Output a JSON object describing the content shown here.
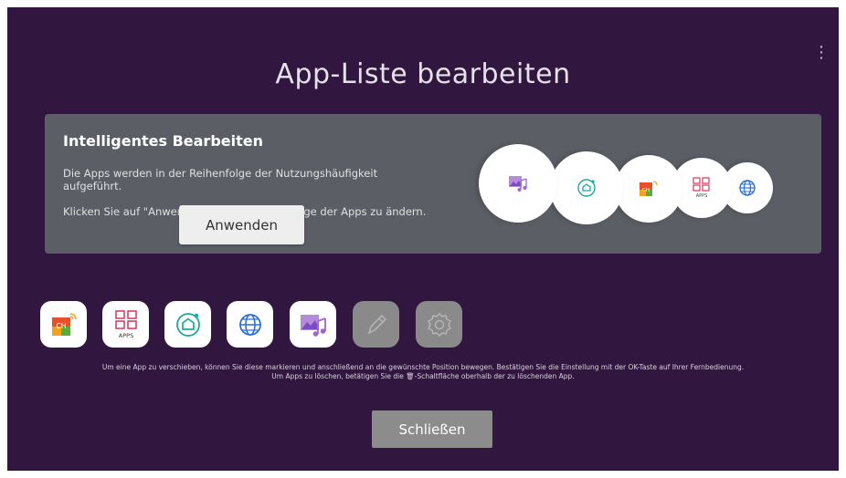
{
  "header": {
    "title": "App-Liste bearbeiten",
    "menu_icon": "more-vertical-icon"
  },
  "smart_edit": {
    "heading": "Intelligentes Bearbeiten",
    "description_line1": "Die Apps werden in der Reihenfolge der Nutzungshäufigkeit aufgeführt.",
    "description_line2": "Klicken Sie auf \"Anwenden\", um die Reihenfolge der Apps zu ändern.",
    "apply_label": "Anwenden",
    "preview_icons": [
      "photo-music-icon",
      "home-dashboard-icon",
      "live-tv-ch-icon",
      "apps-grid-icon",
      "web-browser-icon"
    ]
  },
  "apps": [
    {
      "name": "live-tv-ch-icon",
      "badge": "CH",
      "enabled": true
    },
    {
      "name": "apps-grid-icon",
      "badge": "APPS",
      "enabled": true
    },
    {
      "name": "home-dashboard-icon",
      "enabled": true
    },
    {
      "name": "web-browser-icon",
      "enabled": true
    },
    {
      "name": "photo-music-icon",
      "enabled": true
    },
    {
      "name": "edit-pencil-icon",
      "enabled": false
    },
    {
      "name": "settings-gear-icon",
      "enabled": false
    }
  ],
  "hint": {
    "line1": "Um eine App zu verschieben, können Sie diese markieren und anschließend an die gewünschte Position bewegen. Bestätigen Sie die Einstellung mit der OK-Taste auf Ihrer Fernbedienung.",
    "line2": "Um Apps zu löschen, betätigen Sie die 🗑-Schaltfläche oberhalb der zu löschenden App."
  },
  "footer": {
    "close_label": "Schließen"
  },
  "colors": {
    "background": "#31173f",
    "panel": "#5b5f65",
    "accent_purple": "#9c64d6",
    "accent_pink": "#d4375d",
    "accent_teal": "#1aa9a0",
    "accent_blue": "#2c6fd6"
  }
}
